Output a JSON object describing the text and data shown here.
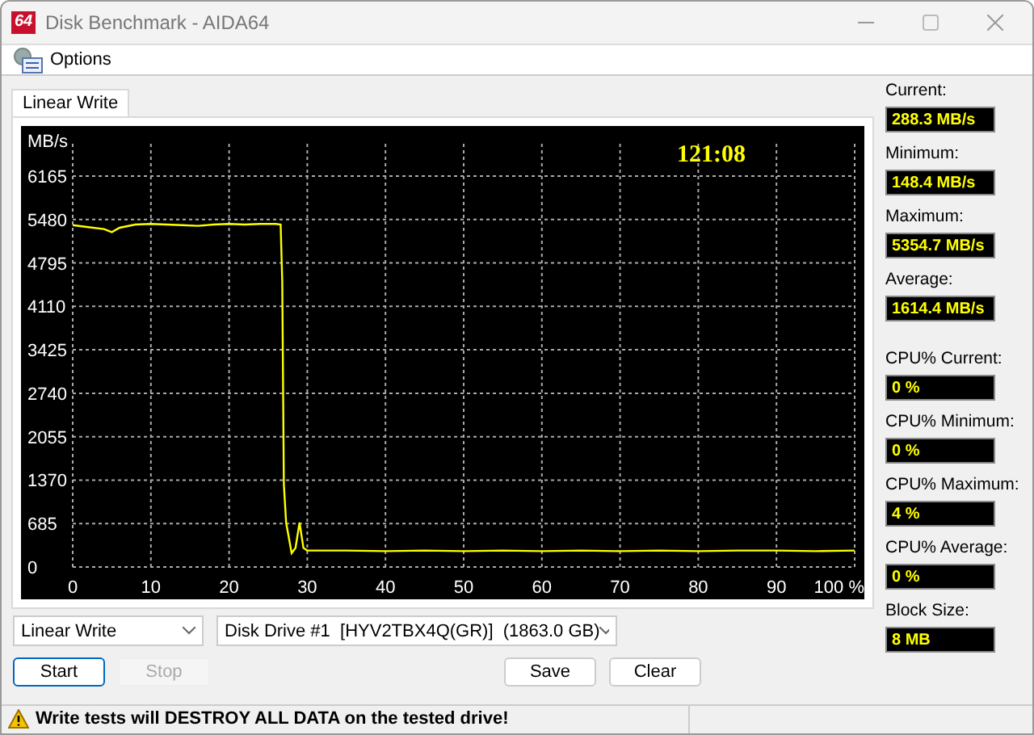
{
  "window": {
    "logo": "64",
    "title": "Disk Benchmark - AIDA64"
  },
  "menu": [
    {
      "label": "Options"
    }
  ],
  "tabs": [
    {
      "label": "Linear Write",
      "selected": true
    }
  ],
  "chart": {
    "elapsed": "121:08",
    "chart_data": {
      "type": "line",
      "ylabel": "MB/s",
      "xlim": [
        0,
        100
      ],
      "ylim": [
        0,
        6165
      ],
      "xticks": [
        0,
        10,
        20,
        30,
        40,
        50,
        60,
        70,
        80,
        90,
        {
          "value": 100,
          "label": "100 %"
        }
      ],
      "yticks": [
        0,
        685,
        1370,
        2055,
        2740,
        3425,
        4110,
        4795,
        5480,
        6165
      ],
      "x": [
        0,
        2,
        4,
        5,
        6,
        8,
        10,
        12,
        14,
        16,
        18,
        20,
        22,
        24,
        26,
        26.6,
        26.8,
        27,
        27.3,
        28,
        28.5,
        29,
        29.5,
        30,
        35,
        40,
        45,
        50,
        55,
        60,
        65,
        70,
        75,
        80,
        85,
        90,
        95,
        100
      ],
      "grid": true,
      "series": [
        {
          "color": "#ffff00",
          "values": [
            5390,
            5360,
            5330,
            5280,
            5350,
            5400,
            5410,
            5400,
            5390,
            5380,
            5400,
            5410,
            5400,
            5410,
            5410,
            5400,
            4500,
            1300,
            700,
            220,
            300,
            700,
            300,
            260,
            260,
            250,
            260,
            250,
            260,
            250,
            260,
            250,
            260,
            250,
            260,
            260,
            250,
            260
          ]
        }
      ]
    }
  },
  "stats": [
    {
      "label": "Current:",
      "value": "288.3 MB/s"
    },
    {
      "label": "Minimum:",
      "value": "148.4 MB/s"
    },
    {
      "label": "Maximum:",
      "value": "5354.7 MB/s"
    },
    {
      "label": "Average:",
      "value": "1614.4 MB/s"
    },
    {
      "label": "CPU% Current:",
      "value": "0 %"
    },
    {
      "label": "CPU% Minimum:",
      "value": "0 %"
    },
    {
      "label": "CPU% Maximum:",
      "value": "4 %"
    },
    {
      "label": "CPU% Average:",
      "value": "0 %"
    },
    {
      "label": "Block Size:",
      "value": "8 MB"
    }
  ],
  "selects": [
    {
      "value": "Linear Write"
    },
    {
      "value": "Disk Drive #1  [HYV2TBX4Q(GR)]  (1863.0 GB)"
    }
  ],
  "buttons": [
    {
      "label": "Start",
      "disabled": false,
      "focused": true
    },
    {
      "label": "Stop",
      "disabled": true,
      "focused": false
    },
    {
      "label": "Save",
      "disabled": false,
      "focused": false
    },
    {
      "label": "Clear",
      "disabled": false,
      "focused": false
    }
  ],
  "status_bar": {
    "warning": "Write tests will DESTROY ALL DATA on the tested drive!"
  }
}
